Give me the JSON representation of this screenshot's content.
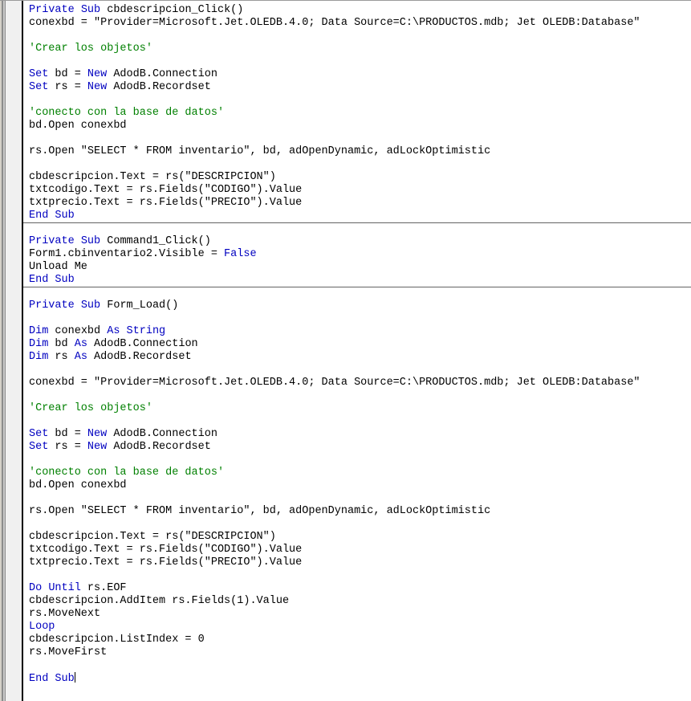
{
  "window": {
    "title": "Visual Basic Code Editor",
    "colors": {
      "background": "#ffffff",
      "keyword": "#0000c0",
      "comment": "#008000",
      "text": "#000000",
      "margin_bar": "#f0f0f0",
      "separator": "#646464"
    }
  },
  "editor": {
    "margin_indicator_bar": "",
    "caret_after_line": "End Sub",
    "procedures": [
      {
        "name": "cbdescripcion_Click",
        "lines": [
          [
            {
              "t": "Private",
              "c": "kw"
            },
            {
              "t": " ",
              "c": "pl"
            },
            {
              "t": "Sub",
              "c": "kw"
            },
            {
              "t": " cbdescripcion_Click()",
              "c": "pl"
            }
          ],
          [
            {
              "t": "conexbd = \"Provider=Microsoft.Jet.OLEDB.4.0; Data Source=C:\\PRODUCTOS.mdb; Jet OLEDB:Database\"",
              "c": "pl"
            }
          ],
          [],
          [
            {
              "t": "'Crear los objetos'",
              "c": "cm"
            }
          ],
          [],
          [
            {
              "t": "Set",
              "c": "kw"
            },
            {
              "t": " bd = ",
              "c": "pl"
            },
            {
              "t": "New",
              "c": "kw"
            },
            {
              "t": " AdodB.Connection",
              "c": "pl"
            }
          ],
          [
            {
              "t": "Set",
              "c": "kw"
            },
            {
              "t": " rs = ",
              "c": "pl"
            },
            {
              "t": "New",
              "c": "kw"
            },
            {
              "t": " AdodB.Recordset",
              "c": "pl"
            }
          ],
          [],
          [
            {
              "t": "'conecto con la base de datos'",
              "c": "cm"
            }
          ],
          [
            {
              "t": "bd.Open conexbd",
              "c": "pl"
            }
          ],
          [],
          [
            {
              "t": "rs.Open \"SELECT * FROM inventario\", bd, adOpenDynamic, adLockOptimistic",
              "c": "pl"
            }
          ],
          [],
          [
            {
              "t": "cbdescripcion.Text = rs(\"DESCRIPCION\")",
              "c": "pl"
            }
          ],
          [
            {
              "t": "txtcodigo.Text = rs.Fields(\"CODIGO\").Value",
              "c": "pl"
            }
          ],
          [
            {
              "t": "txtprecio.Text = rs.Fields(\"PRECIO\").Value",
              "c": "pl"
            }
          ],
          [
            {
              "t": "End",
              "c": "kw"
            },
            {
              "t": " ",
              "c": "pl"
            },
            {
              "t": "Sub",
              "c": "kw"
            }
          ]
        ]
      },
      {
        "name": "Command1_Click",
        "lines": [
          [],
          [
            {
              "t": "Private",
              "c": "kw"
            },
            {
              "t": " ",
              "c": "pl"
            },
            {
              "t": "Sub",
              "c": "kw"
            },
            {
              "t": " Command1_Click()",
              "c": "pl"
            }
          ],
          [
            {
              "t": "Form1.cbinventario2.Visible = ",
              "c": "pl"
            },
            {
              "t": "False",
              "c": "kw"
            }
          ],
          [
            {
              "t": "Unload Me",
              "c": "pl"
            }
          ],
          [
            {
              "t": "End",
              "c": "kw"
            },
            {
              "t": " ",
              "c": "pl"
            },
            {
              "t": "Sub",
              "c": "kw"
            }
          ]
        ]
      },
      {
        "name": "Form_Load",
        "lines": [
          [],
          [
            {
              "t": "Private",
              "c": "kw"
            },
            {
              "t": " ",
              "c": "pl"
            },
            {
              "t": "Sub",
              "c": "kw"
            },
            {
              "t": " Form_Load()",
              "c": "pl"
            }
          ],
          [],
          [
            {
              "t": "Dim",
              "c": "kw"
            },
            {
              "t": " conexbd ",
              "c": "pl"
            },
            {
              "t": "As",
              "c": "kw"
            },
            {
              "t": " ",
              "c": "pl"
            },
            {
              "t": "String",
              "c": "kw"
            }
          ],
          [
            {
              "t": "Dim",
              "c": "kw"
            },
            {
              "t": " bd ",
              "c": "pl"
            },
            {
              "t": "As",
              "c": "kw"
            },
            {
              "t": " AdodB.Connection",
              "c": "pl"
            }
          ],
          [
            {
              "t": "Dim",
              "c": "kw"
            },
            {
              "t": " rs ",
              "c": "pl"
            },
            {
              "t": "As",
              "c": "kw"
            },
            {
              "t": " AdodB.Recordset",
              "c": "pl"
            }
          ],
          [],
          [
            {
              "t": "conexbd = \"Provider=Microsoft.Jet.OLEDB.4.0; Data Source=C:\\PRODUCTOS.mdb; Jet OLEDB:Database\"",
              "c": "pl"
            }
          ],
          [],
          [
            {
              "t": "'Crear los objetos'",
              "c": "cm"
            }
          ],
          [],
          [
            {
              "t": "Set",
              "c": "kw"
            },
            {
              "t": " bd = ",
              "c": "pl"
            },
            {
              "t": "New",
              "c": "kw"
            },
            {
              "t": " AdodB.Connection",
              "c": "pl"
            }
          ],
          [
            {
              "t": "Set",
              "c": "kw"
            },
            {
              "t": " rs = ",
              "c": "pl"
            },
            {
              "t": "New",
              "c": "kw"
            },
            {
              "t": " AdodB.Recordset",
              "c": "pl"
            }
          ],
          [],
          [
            {
              "t": "'conecto con la base de datos'",
              "c": "cm"
            }
          ],
          [
            {
              "t": "bd.Open conexbd",
              "c": "pl"
            }
          ],
          [],
          [
            {
              "t": "rs.Open \"SELECT * FROM inventario\", bd, adOpenDynamic, adLockOptimistic",
              "c": "pl"
            }
          ],
          [],
          [
            {
              "t": "cbdescripcion.Text = rs(\"DESCRIPCION\")",
              "c": "pl"
            }
          ],
          [
            {
              "t": "txtcodigo.Text = rs.Fields(\"CODIGO\").Value",
              "c": "pl"
            }
          ],
          [
            {
              "t": "txtprecio.Text = rs.Fields(\"PRECIO\").Value",
              "c": "pl"
            }
          ],
          [],
          [
            {
              "t": "Do",
              "c": "kw"
            },
            {
              "t": " ",
              "c": "pl"
            },
            {
              "t": "Until",
              "c": "kw"
            },
            {
              "t": " rs.EOF",
              "c": "pl"
            }
          ],
          [
            {
              "t": "cbdescripcion.AddItem rs.Fields(1).Value",
              "c": "pl"
            }
          ],
          [
            {
              "t": "rs.MoveNext",
              "c": "pl"
            }
          ],
          [
            {
              "t": "Loop",
              "c": "kw"
            }
          ],
          [
            {
              "t": "cbdescripcion.ListIndex = 0",
              "c": "pl"
            }
          ],
          [
            {
              "t": "rs.MoveFirst",
              "c": "pl"
            }
          ],
          [],
          [
            {
              "t": "End",
              "c": "kw"
            },
            {
              "t": " ",
              "c": "pl"
            },
            {
              "t": "Sub",
              "c": "kw"
            },
            {
              "t": "__CARET__",
              "c": "caret"
            }
          ]
        ]
      }
    ]
  }
}
